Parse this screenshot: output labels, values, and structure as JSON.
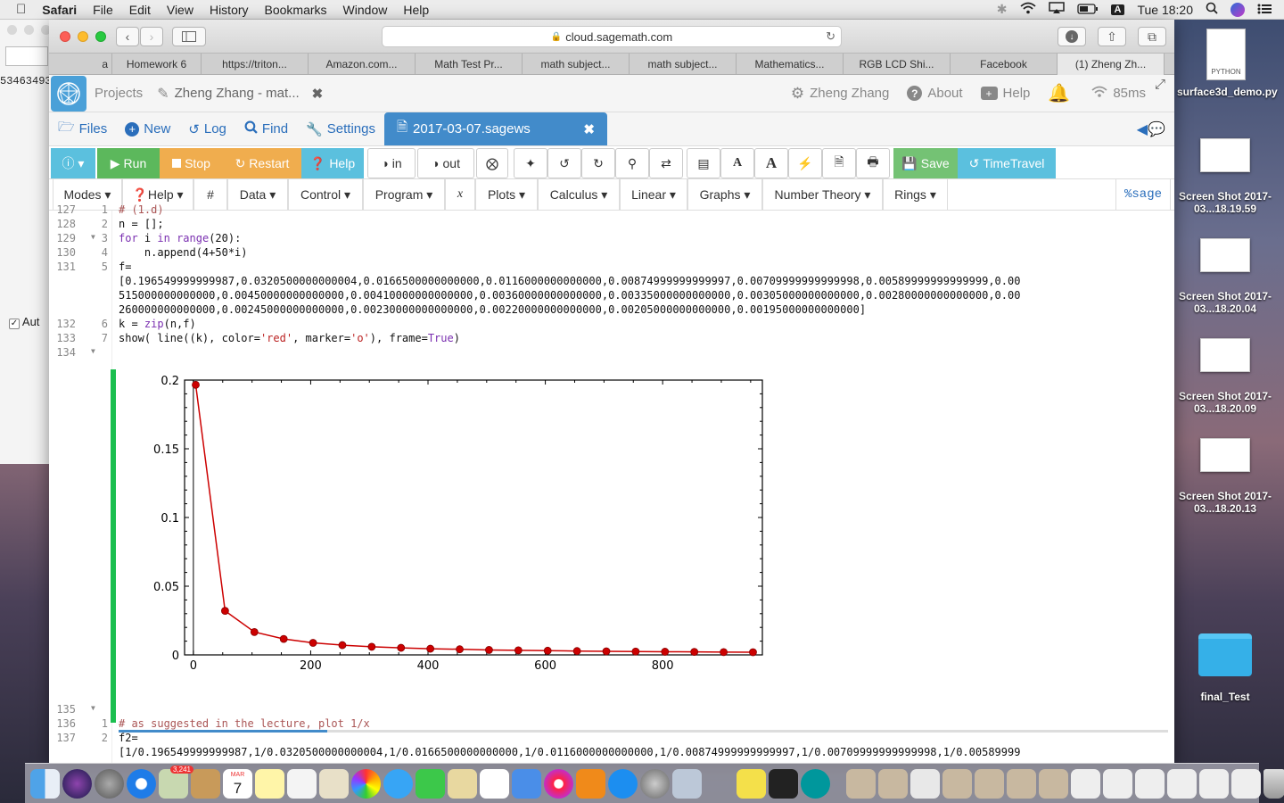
{
  "menubar": {
    "apple": "",
    "app": "Safari",
    "items": [
      "File",
      "Edit",
      "View",
      "History",
      "Bookmarks",
      "Window",
      "Help"
    ],
    "status_letter": "A",
    "clock": "Tue 18:20"
  },
  "bg_window": {
    "text": "53463493",
    "checkbox_label": "Aut"
  },
  "browser": {
    "url": "cloud.sagemath.com",
    "tabs": [
      "a",
      "Homework 6",
      "https://triton...",
      "Amazon.com...",
      "Math Test Pr...",
      "math subject...",
      "math subject...",
      "Mathematics...",
      "RGB LCD Shi...",
      "Facebook",
      "(1) Zheng Zh..."
    ],
    "new_tab": "+"
  },
  "sage": {
    "projects": "Projects",
    "project_title": "Zheng Zhang - mat...",
    "user": "Zheng Zhang",
    "about": "About",
    "help": "Help",
    "ping": "85ms",
    "files": "Files",
    "new": "New",
    "log": "Log",
    "find": "Find",
    "settings": "Settings",
    "file_tab": "2017-03-07.sagews",
    "buttons": {
      "run": "Run",
      "stop": "Stop",
      "restart": "Restart",
      "help": "Help",
      "in": "in",
      "out": "out",
      "save": "Save",
      "timetravel": "TimeTravel"
    },
    "menus": [
      "Modes",
      "Help",
      "#",
      "Data",
      "Control",
      "Program",
      "x",
      "Plots",
      "Calculus",
      "Linear",
      "Graphs",
      "Number Theory",
      "Rings"
    ],
    "mode": "%sage"
  },
  "code": {
    "lines": [
      {
        "n": "127",
        "r": "1",
        "t": "# (1.d)"
      },
      {
        "n": "128",
        "r": "2",
        "t": "n = [];"
      },
      {
        "n": "129",
        "r": "3",
        "t": "for i in range(20):"
      },
      {
        "n": "130",
        "r": "4",
        "t": "    n.append(4+50*i)"
      },
      {
        "n": "131",
        "r": "5",
        "t": "f="
      },
      {
        "n": "",
        "r": "",
        "t": "[0.196549999999987,0.0320500000000004,0.0166500000000000,0.0116000000000000,0.00874999999999997,0.00709999999999998,0.00589999999999999,0.00"
      },
      {
        "n": "",
        "r": "",
        "t": "515000000000000,0.00450000000000000,0.00410000000000000,0.00360000000000000,0.00335000000000000,0.00305000000000000,0.00280000000000000,0.00"
      },
      {
        "n": "",
        "r": "",
        "t": "260000000000000,0.00245000000000000,0.00230000000000000,0.00220000000000000,0.00205000000000000,0.00195000000000000]"
      },
      {
        "n": "132",
        "r": "6",
        "t": "k = zip(n,f)"
      },
      {
        "n": "133",
        "r": "7",
        "t": "show( line((k), color='red', marker='o'), frame=True)"
      },
      {
        "n": "134",
        "r": "",
        "t": ""
      }
    ],
    "lines2": [
      {
        "n": "135",
        "r": "",
        "t": ""
      },
      {
        "n": "136",
        "r": "1",
        "t": "# as suggested in the lecture, plot 1/x"
      },
      {
        "n": "137",
        "r": "2",
        "t": "f2="
      },
      {
        "n": "",
        "r": "",
        "t": "[1/0.196549999999987,1/0.0320500000000004,1/0.0166500000000000,1/0.0116000000000000,1/0.00874999999999997,1/0.00709999999999998,1/0.00589999"
      }
    ]
  },
  "chart_data": {
    "type": "line",
    "color": "#cc0000",
    "marker": "o",
    "x": [
      4,
      54,
      104,
      154,
      204,
      254,
      304,
      354,
      404,
      454,
      504,
      554,
      604,
      654,
      704,
      754,
      804,
      854,
      904,
      954
    ],
    "y": [
      0.19655,
      0.03205,
      0.01665,
      0.0116,
      0.00875,
      0.0071,
      0.0059,
      0.00515,
      0.0045,
      0.0041,
      0.0036,
      0.00335,
      0.00305,
      0.0028,
      0.0026,
      0.00245,
      0.0023,
      0.0022,
      0.00205,
      0.00195
    ],
    "xlim": [
      -15,
      970
    ],
    "ylim": [
      0,
      0.2
    ],
    "xticks": [
      0,
      200,
      400,
      600,
      800
    ],
    "xtick_labels": [
      "0",
      "200",
      "400",
      "600",
      "800"
    ],
    "yticks": [
      0,
      0.05,
      0.1,
      0.15,
      0.2
    ],
    "ytick_labels": [
      "0",
      "0.05",
      "0.1",
      "0.15",
      "0.2"
    ],
    "frame": true
  },
  "desktop": {
    "icons": [
      {
        "label": "surface3d_demo.py",
        "badge": "PYTHON"
      },
      {
        "label": "Screen Shot 2017-03...18.19.59"
      },
      {
        "label": "Screen Shot 2017-03...18.20.04"
      },
      {
        "label": "Screen Shot 2017-03...18.20.09"
      },
      {
        "label": "Screen Shot 2017-03...18.20.13"
      },
      {
        "label": "final_Test"
      }
    ]
  },
  "dock": {
    "badge": "3,241",
    "calendar_month": "MAR",
    "calendar_day": "7"
  }
}
